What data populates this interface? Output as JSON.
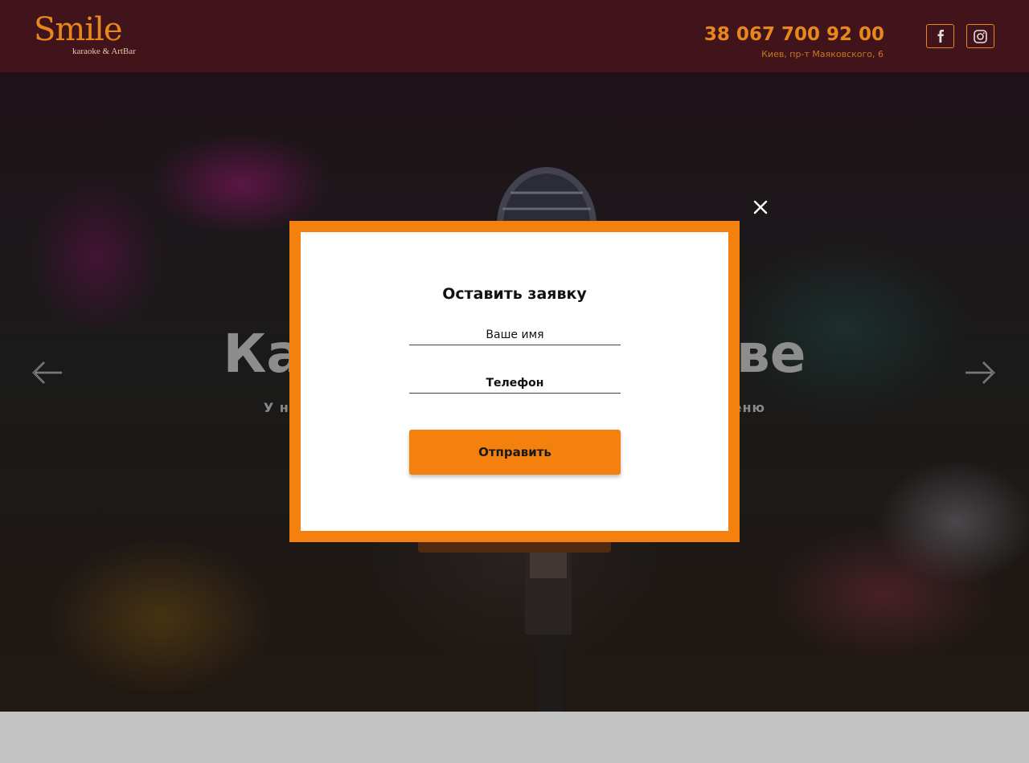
{
  "header": {
    "logo_text": "Smile",
    "logo_subtitle": "karaoke & ArtBar",
    "phone": "38 067 700 92 00",
    "address": "Киев, пр-т Маяковского, 6",
    "social": [
      {
        "icon": "facebook-icon"
      },
      {
        "icon": "instagram-icon"
      }
    ],
    "accent_color": "#e8871b",
    "background_color": "#40141a"
  },
  "hero": {
    "title_visible_left": "Ка",
    "title_visible_right": "ве",
    "subtitle_visible_left": "У на",
    "subtitle_visible_right": "еню"
  },
  "modal": {
    "title": "Оставить заявку",
    "name_placeholder": "Ваше имя",
    "phone_placeholder": "Телефон",
    "submit_label": "Отправить",
    "frame_color": "#f4810e"
  }
}
